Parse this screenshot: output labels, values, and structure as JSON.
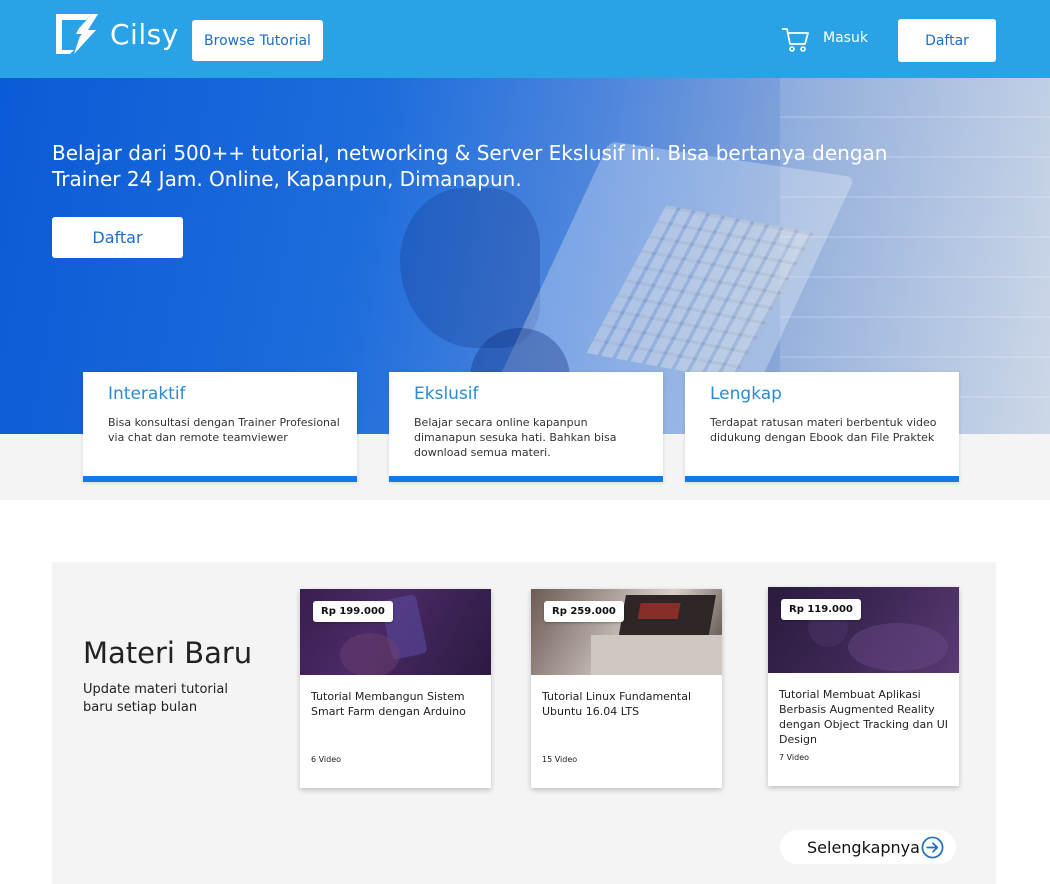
{
  "header": {
    "brand": "Cilsy",
    "browse_label": "Browse Tutorial",
    "login_label": "Masuk",
    "register_label": "Daftar",
    "bg_color": "#2aa3e6"
  },
  "hero": {
    "headline": "Belajar dari 500++ tutorial, networking & Server Ekslusif ini. Bisa bertanya dengan Trainer 24 Jam. Online, Kapanpun, Dimanapun.",
    "cta_label": "Daftar"
  },
  "features": [
    {
      "title": "Interaktif",
      "desc": "Bisa konsultasi dengan Trainer Profesional via chat dan remote teamviewer"
    },
    {
      "title": "Ekslusif",
      "desc": "Belajar secara online kapanpun dimanapun sesuka hati. Bahkan bisa download semua materi."
    },
    {
      "title": "Lengkap",
      "desc": "Terdapat ratusan materi berbentuk video didukung dengan Ebook dan File Praktek"
    }
  ],
  "materi": {
    "title": "Materi Baru",
    "subtitle": "Update materi tutorial baru setiap bulan",
    "more_label": "Selengkapnya",
    "cards": [
      {
        "price": "Rp 199.000",
        "title": "Tutorial Membangun Sistem Smart Farm dengan Arduino",
        "count": "6 Video"
      },
      {
        "price": "Rp 259.000",
        "title": "Tutorial Linux Fundamental Ubuntu 16.04 LTS",
        "count": "15 Video"
      },
      {
        "price": "Rp 119.000",
        "title": "Tutorial Membuat Aplikasi Berbasis Augmented Reality dengan Object Tracking dan UI Design",
        "count": "7 Video"
      }
    ]
  },
  "colors": {
    "accent": "#1478e8",
    "feature_title": "#2a8ad6",
    "button_text": "#1b6fc4"
  }
}
